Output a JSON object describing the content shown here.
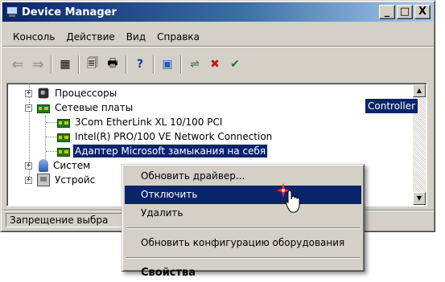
{
  "window": {
    "title": "Device Manager",
    "app_icon": "device-manager-icon"
  },
  "title_buttons": {
    "minimize": "_",
    "maximize": "□",
    "close": "X"
  },
  "menubar": {
    "items": [
      "Консоль",
      "Действие",
      "Вид",
      "Справка"
    ]
  },
  "toolbar": {
    "items": [
      {
        "name": "back-arrow-icon",
        "glyph": "⇐"
      },
      {
        "name": "forward-arrow-icon",
        "glyph": "⇒"
      },
      {
        "name": "properties-view-icon",
        "glyph": "▦"
      },
      {
        "name": "properties-icon",
        "glyph": "🗐"
      },
      {
        "name": "print-icon",
        "glyph": "🖶"
      },
      {
        "name": "help-icon",
        "glyph": "?"
      },
      {
        "name": "device-view-icon",
        "glyph": "▣"
      },
      {
        "name": "scan-hardware-icon",
        "glyph": "⇌"
      },
      {
        "name": "uninstall-icon",
        "glyph": "✖"
      },
      {
        "name": "enable-icon",
        "glyph": "✔"
      }
    ]
  },
  "tree": {
    "items": [
      {
        "label": "Процессоры",
        "icon": "processor-icon",
        "expander": "+"
      },
      {
        "label": "Сетевые платы",
        "icon": "network-adapter-icon",
        "expander": "−"
      },
      {
        "label": "3Com EtherLink XL 10/100 PCI",
        "icon": "network-adapter-icon"
      },
      {
        "label": "Intel(R) PRO/100 VE Network Connection",
        "icon": "network-adapter-icon"
      },
      {
        "label": "Адаптер Microsoft замыкания на себя",
        "icon": "network-adapter-icon",
        "selected": true
      },
      {
        "label": "Систем",
        "icon": "system-devices-icon",
        "expander": "+"
      },
      {
        "label": "Устройс",
        "icon": "devices-icon",
        "expander": "+"
      }
    ],
    "obscured_fragment": "Controller"
  },
  "statusbar": {
    "text": "Запрещение выбра"
  },
  "context_menu": {
    "items": [
      {
        "label": "Обновить драйвер..."
      },
      {
        "label": "Отключить",
        "highlighted": true
      },
      {
        "label": "Удалить"
      },
      {
        "label": "Обновить конфигурацию оборудования"
      },
      {
        "label": "Свойства",
        "bold": true
      }
    ]
  },
  "colors": {
    "selection": "#0a246a",
    "face": "#d4d0c8",
    "title_start": "#0a246a",
    "title_end": "#a6caf0"
  }
}
